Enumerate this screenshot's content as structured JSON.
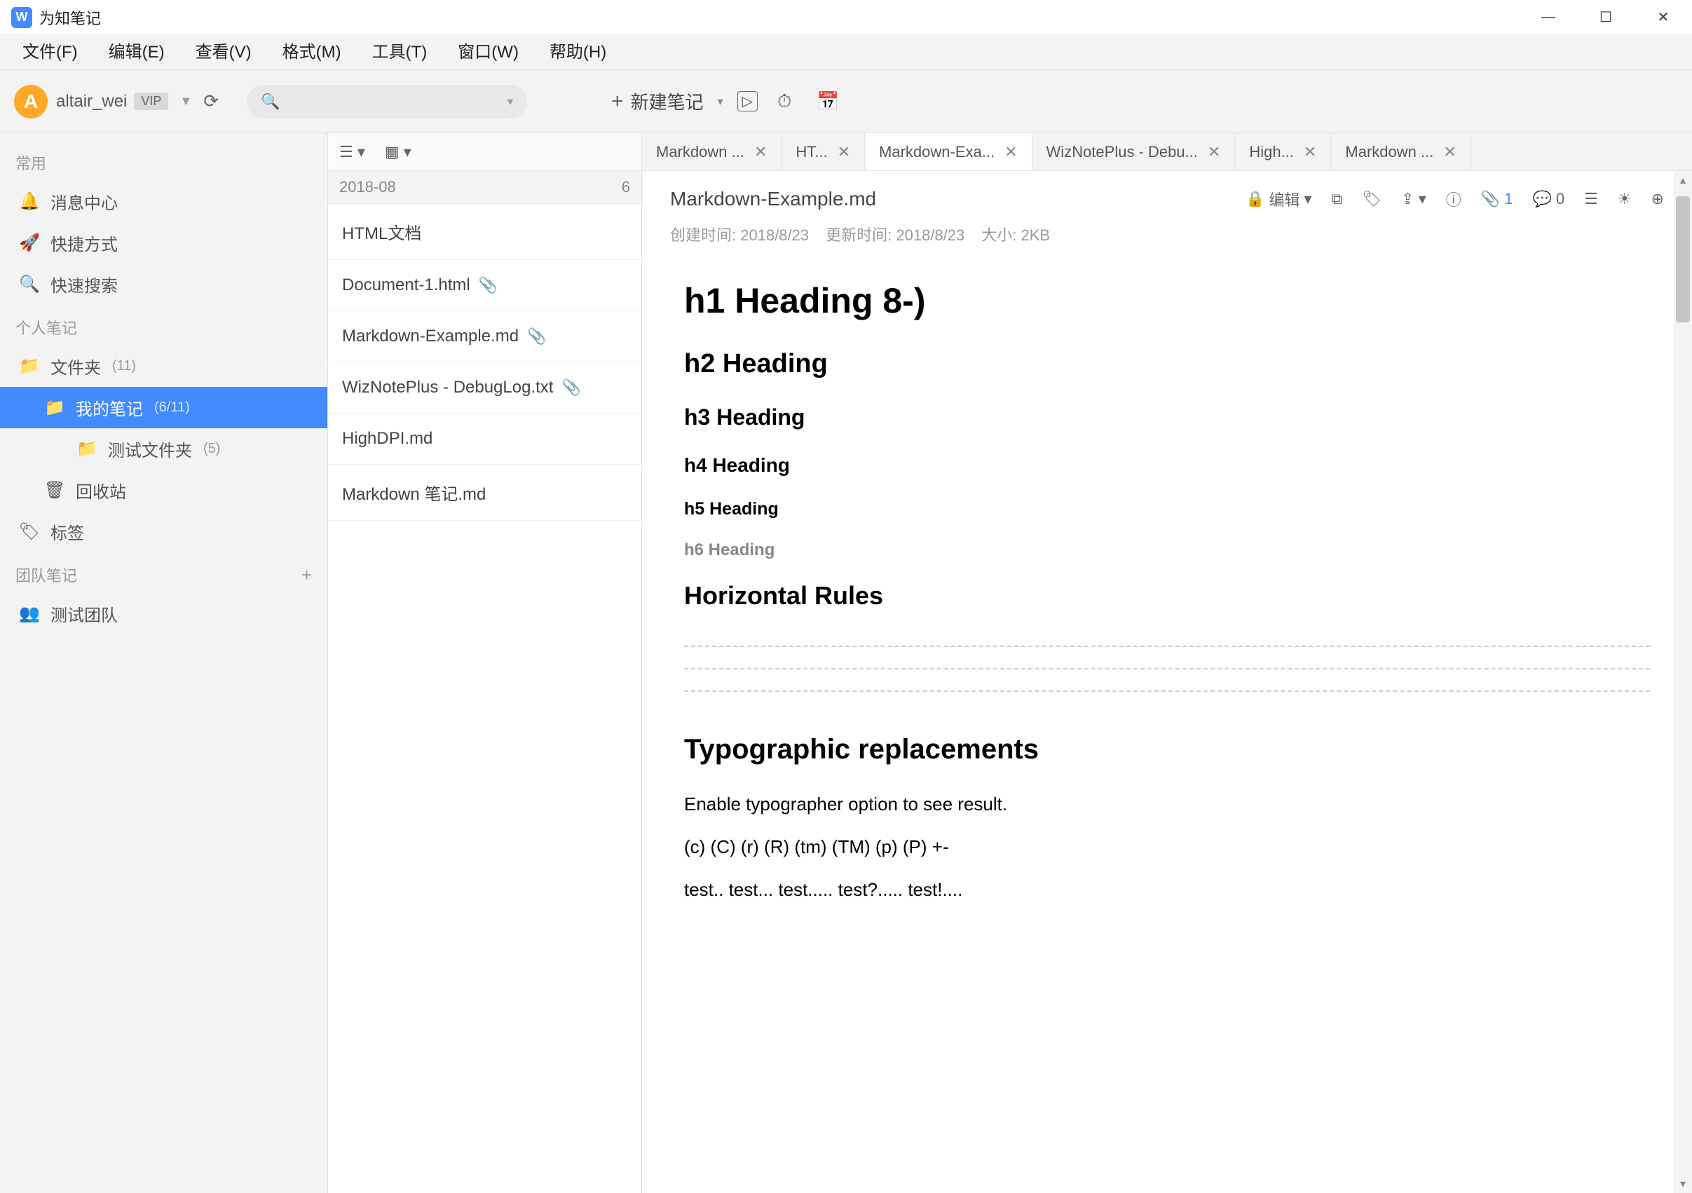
{
  "window": {
    "title": "为知笔记"
  },
  "menubar": [
    "文件(F)",
    "编辑(E)",
    "查看(V)",
    "格式(M)",
    "工具(T)",
    "窗口(W)",
    "帮助(H)"
  ],
  "user": {
    "initial": "A",
    "name": "altair_wei",
    "badge": "VIP"
  },
  "newnote_label": "新建笔记",
  "sidebar": {
    "common_label": "常用",
    "common_items": [
      "消息中心",
      "快捷方式",
      "快速搜索"
    ],
    "personal_label": "个人笔记",
    "folder_root": {
      "label": "文件夹",
      "count": "(11)"
    },
    "folder_mynotes": {
      "label": "我的笔记",
      "count": "(6/11)"
    },
    "folder_test": {
      "label": "测试文件夹",
      "count": "(5)"
    },
    "recycle": "回收站",
    "tags": "标签",
    "team_label": "团队笔记",
    "team_item": "测试团队"
  },
  "notelist": {
    "group_date": "2018-08",
    "group_count": "6",
    "items": [
      {
        "title": "HTML文档",
        "clip": false
      },
      {
        "title": "Document-1.html",
        "clip": true
      },
      {
        "title": "Markdown-Example.md",
        "clip": true
      },
      {
        "title": "WizNotePlus - DebugLog.txt",
        "clip": true
      },
      {
        "title": "HighDPI.md",
        "clip": false
      },
      {
        "title": "Markdown 笔记.md",
        "clip": false
      }
    ]
  },
  "tabs": [
    {
      "label": "Markdown ...",
      "active": false
    },
    {
      "label": "HT...",
      "active": false
    },
    {
      "label": "Markdown-Exa...",
      "active": true
    },
    {
      "label": "WizNotePlus - Debu...",
      "active": false
    },
    {
      "label": "High...",
      "active": false
    },
    {
      "label": "Markdown ...",
      "active": false
    }
  ],
  "doc": {
    "title": "Markdown-Example.md",
    "edit_label": "编辑",
    "attach_count": "1",
    "comment_count": "0",
    "created_label": "创建时间:",
    "created_value": "2018/8/23",
    "updated_label": "更新时间:",
    "updated_value": "2018/8/23",
    "size_label": "大小:",
    "size_value": "2KB",
    "h1": "h1 Heading 8-)",
    "h2": "h2 Heading",
    "h3": "h3 Heading",
    "h4": "h4 Heading",
    "h5": "h5 Heading",
    "h6": "h6 Heading",
    "hr_title": "Horizontal Rules",
    "typo_title": "Typographic replacements",
    "typo_p1": "Enable typographer option to see result.",
    "typo_p2": "(c) (C) (r) (R) (tm) (TM) (p) (P) +-",
    "typo_p3": "test.. test... test..... test?..... test!...."
  }
}
